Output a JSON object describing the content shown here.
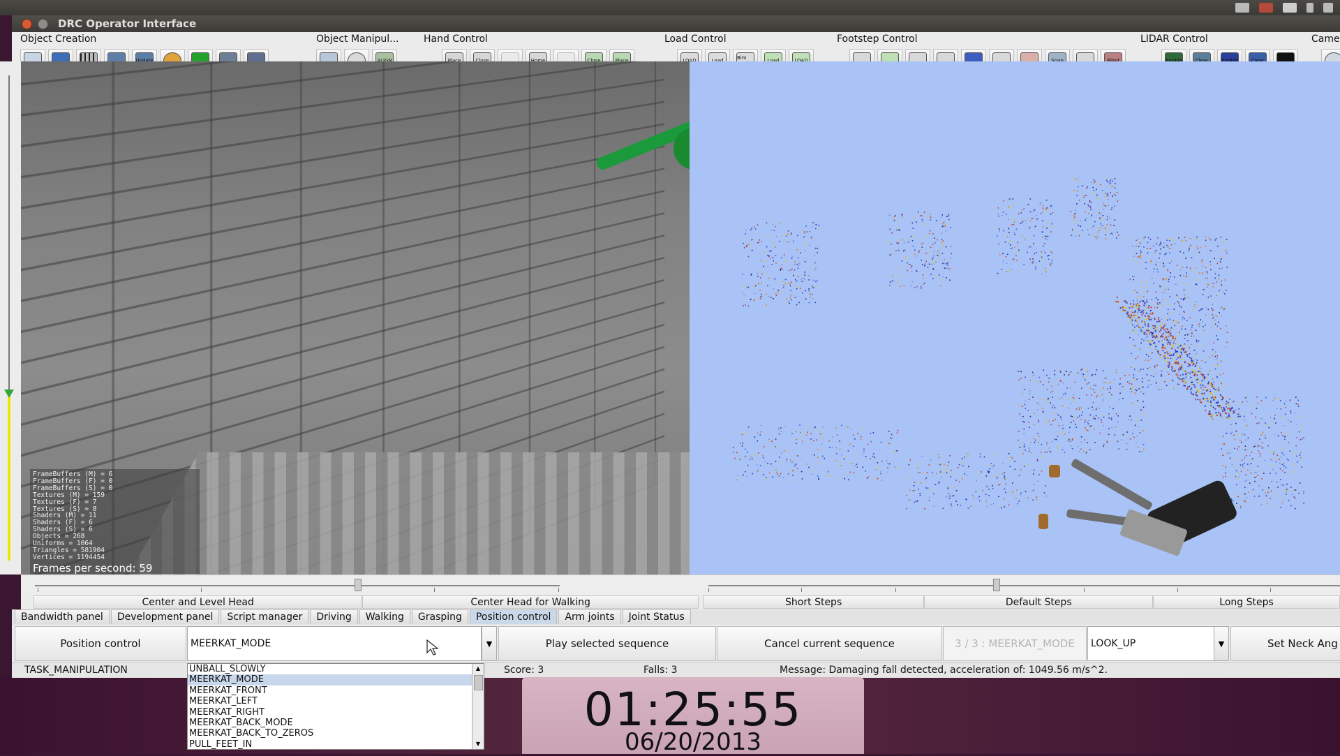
{
  "window": {
    "title": "DRC Operator Interface"
  },
  "toolbar": {
    "groups": [
      {
        "label": "Object Creation",
        "icons": [
          "cursor-box-icon",
          "cube-icon",
          "grid-icon",
          "vehicle-icon",
          "update-icon",
          "ring-icon",
          "green-box-icon",
          "drill-icon",
          "valve-icon"
        ]
      },
      {
        "label": "Object Manipul...",
        "icons": [
          "move-icon",
          "rotate-icon",
          "align-icon"
        ]
      },
      {
        "label": "Hand Control",
        "icons": [
          "place-hand-icon",
          "close-hand-icon",
          "blank-icon",
          "home-hand-icon",
          "blank-icon",
          "close-hand-2-icon",
          "place-hand-2-icon"
        ]
      },
      {
        "label": "Load Control",
        "icons": [
          "load-icon",
          "load-2-icon",
          "bim-load-icon",
          "load-3-icon",
          "load-4-icon"
        ]
      },
      {
        "label": "Footstep Control",
        "icons": [
          "footstep-icon",
          "footstep-2-icon",
          "footstep-3-icon",
          "footstep-4-icon",
          "dots-icon",
          "path-icon",
          "cancel-steps-icon",
          "snap-icon",
          "turn-icon",
          "blind-icon"
        ]
      },
      {
        "label": "LIDAR Control",
        "icons": [
          "lidar-enable-icon",
          "lidar-clear-icon",
          "lidar-enable-2-icon",
          "lidar-clear-2-icon",
          "black-box-icon"
        ]
      },
      {
        "label": "Came",
        "icons": [
          "eye-icon"
        ]
      }
    ],
    "icon_glyphs": {
      "update": "Update",
      "align": "ALIGN",
      "place": "Place",
      "close": "Close",
      "home": "Home",
      "load": "LOAD",
      "load2": "Load",
      "bimload": "Bim Load",
      "snap": "Snap",
      "blind": "Blind",
      "enable": "Enable",
      "clear": "Clear"
    }
  },
  "camera": {
    "stats": [
      "FrameBuffers (M) = 6",
      "FrameBuffers (F) = 0",
      "FrameBuffers (S) = 0",
      "Textures (M) = 159",
      "Textures (F) = 7",
      "Textures (S) = 8",
      "Shaders (M) = 11",
      "Shaders (F) = 6",
      "Shaders (S) = 6",
      "Objects = 268",
      "Uniforms = 1064",
      "Triangles = 581904",
      "Vertices = 1194454"
    ],
    "fps": "Frames per second: 59"
  },
  "presets": {
    "head": [
      "Center and Level Head",
      "Center Head for Walking"
    ],
    "steps": [
      "Short Steps",
      "Default Steps",
      "Long Steps"
    ]
  },
  "tabs": [
    "Bandwidth panel",
    "Development panel",
    "Script manager",
    "Driving",
    "Walking",
    "Grasping",
    "Position control",
    "Arm joints",
    "Joint Status"
  ],
  "active_tab": "Position control",
  "controls": {
    "position_control_label": "Position control",
    "sequence_value": "MEERKAT_MODE",
    "play_label": "Play selected sequence",
    "cancel_label": "Cancel current sequence",
    "progress_text": "3 / 3 : MEERKAT_MODE",
    "neck_value": "LOOK_UP",
    "set_neck_label": "Set Neck Ang"
  },
  "status": {
    "task": "TASK_MANIPULATION",
    "score": "Score:  3",
    "falls": "Falls:  3",
    "message": "Message:  Damaging fall detected, acceleration of: 1049.56 m/s^2."
  },
  "dropdown": {
    "options": [
      "UNBALL_SLOWLY",
      "MEERKAT_MODE",
      "MEERKAT_FRONT",
      "MEERKAT_LEFT",
      "MEERKAT_RIGHT",
      "MEERKAT_BACK_MODE",
      "MEERKAT_BACK_TO_ZEROS",
      "PULL_FEET_IN"
    ],
    "selected": "MEERKAT_MODE"
  },
  "clock": {
    "time": "01:25:55",
    "date": "06/20/2013"
  },
  "colors": {
    "lidar_bg": "#a9c3f7",
    "accent_green": "#1a9a3a",
    "slider_yellow": "#e9e600"
  }
}
